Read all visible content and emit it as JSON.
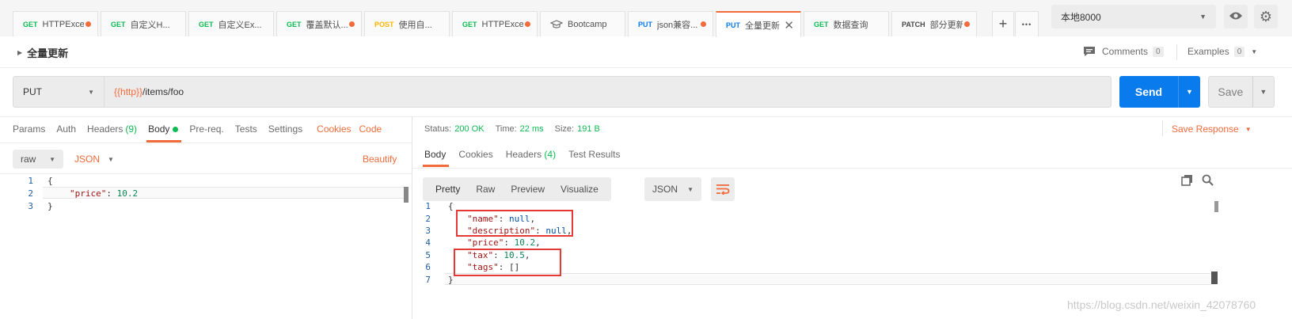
{
  "tabs": [
    {
      "method": "GET",
      "title": "HTTPExce...",
      "dot": true
    },
    {
      "method": "GET",
      "title": "自定义H...",
      "dot": false
    },
    {
      "method": "GET",
      "title": "自定义Ex...",
      "dot": false
    },
    {
      "method": "GET",
      "title": "覆盖默认...",
      "dot": true
    },
    {
      "method": "POST",
      "title": "使用自...",
      "dot": false
    },
    {
      "method": "GET",
      "title": "HTTPExce...",
      "dot": true
    },
    {
      "method": "",
      "title": "Bootcamp",
      "dot": false
    },
    {
      "method": "PUT",
      "title": "json兼容...",
      "dot": true
    },
    {
      "method": "PUT",
      "title": "全量更新",
      "dot": false,
      "active": true
    },
    {
      "method": "GET",
      "title": "数据查询",
      "dot": false
    },
    {
      "method": "PATCH",
      "title": "部分更新",
      "dot": true
    }
  ],
  "tab_controls": {
    "add": "+",
    "more": "•••"
  },
  "environment": {
    "selected": "本地8000"
  },
  "request": {
    "name": "全量更新",
    "comments_label": "Comments",
    "comments_count": "0",
    "examples_label": "Examples",
    "examples_count": "0",
    "method": "PUT",
    "url_var": "{{http}}",
    "url_path": "/items/foo",
    "send_label": "Send",
    "save_label": "Save"
  },
  "request_tabs": {
    "params": "Params",
    "auth": "Auth",
    "headers": "Headers",
    "headers_count": "(9)",
    "body": "Body",
    "prereq": "Pre-req.",
    "tests": "Tests",
    "settings": "Settings",
    "cookies": "Cookies",
    "code": "Code"
  },
  "body_options": {
    "mode": "raw",
    "format": "JSON",
    "beautify": "Beautify"
  },
  "request_body": {
    "lines": [
      "1",
      "2",
      "3"
    ],
    "l1": "{",
    "l2_key": "\"price\"",
    "l2_val": "10.2",
    "l3": "}"
  },
  "response_status": {
    "status_label": "Status:",
    "status_value": "200 OK",
    "time_label": "Time:",
    "time_value": "22 ms",
    "size_label": "Size:",
    "size_value": "191 B",
    "save_response": "Save Response"
  },
  "response_tabs": {
    "body": "Body",
    "cookies": "Cookies",
    "headers": "Headers",
    "headers_count": "(4)",
    "test_results": "Test Results"
  },
  "response_view": {
    "pretty": "Pretty",
    "raw": "Raw",
    "preview": "Preview",
    "visualize": "Visualize",
    "format": "JSON"
  },
  "response_body": {
    "lines": [
      "1",
      "2",
      "3",
      "4",
      "5",
      "6",
      "7"
    ],
    "l1": "{",
    "l2_key": "\"name\"",
    "l2_val": "null",
    "l3_key": "\"description\"",
    "l3_val": "null",
    "l4_key": "\"price\"",
    "l4_val": "10.2",
    "l5_key": "\"tax\"",
    "l5_val": "10.5",
    "l6_key": "\"tags\"",
    "l6_val": "[]",
    "l7": "}"
  },
  "watermark": "https://blog.csdn.net/weixin_42078760",
  "colors": {
    "accent": "#f26b3a",
    "send": "#097bed",
    "get": "#0cbb52",
    "post": "#ffb400",
    "put": "#097bed",
    "annotation": "#e53935"
  }
}
